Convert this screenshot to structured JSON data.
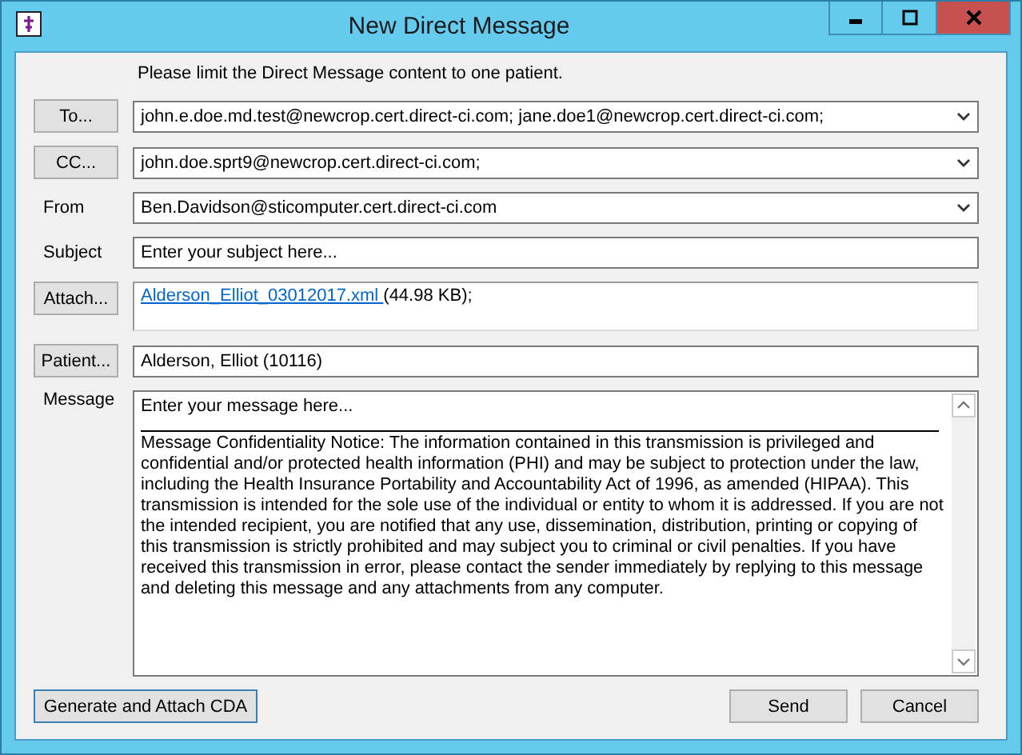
{
  "window": {
    "title": "New Direct Message"
  },
  "notice": "Please limit the Direct Message content to one patient.",
  "to": {
    "label": "To...",
    "value": "john.e.doe.md.test@newcrop.cert.direct-ci.com; jane.doe1@newcrop.cert.direct-ci.com;"
  },
  "cc": {
    "label": "CC...",
    "value": "john.doe.sprt9@newcrop.cert.direct-ci.com;"
  },
  "from": {
    "label": "From",
    "value": "Ben.Davidson@sticomputer.cert.direct-ci.com"
  },
  "subject": {
    "label": "Subject",
    "placeholder": "Enter your subject here..."
  },
  "attach": {
    "label": "Attach...",
    "files": [
      {
        "name": "Alderson_Elliot_03012017.xml ",
        "size": "(44.98 KB);"
      }
    ]
  },
  "patient": {
    "label": "Patient...",
    "value": "Alderson, Elliot (10116)"
  },
  "message": {
    "label": "Message",
    "placeholder": "Enter your message here...",
    "confidentiality": "Message Confidentiality Notice: The information contained in this transmission is privileged and confidential and/or protected health information (PHI) and may be subject to protection under the law, including the Health Insurance Portability and Accountability Act of 1996, as amended (HIPAA). This transmission is intended for the sole use of the individual or entity to whom it is addressed. If you are not the intended recipient, you are notified that any use, dissemination, distribution, printing or copying of this transmission is strictly prohibited and may subject you to criminal or civil penalties. If you have received this transmission in error, please contact the sender immediately by replying to this message and deleting this message and any attachments from any computer."
  },
  "buttons": [
    {
      "label": "Generate and Attach CDA",
      "focused": true
    },
    {
      "label": "Send",
      "focused": false
    },
    {
      "label": "Cancel",
      "focused": false
    }
  ]
}
